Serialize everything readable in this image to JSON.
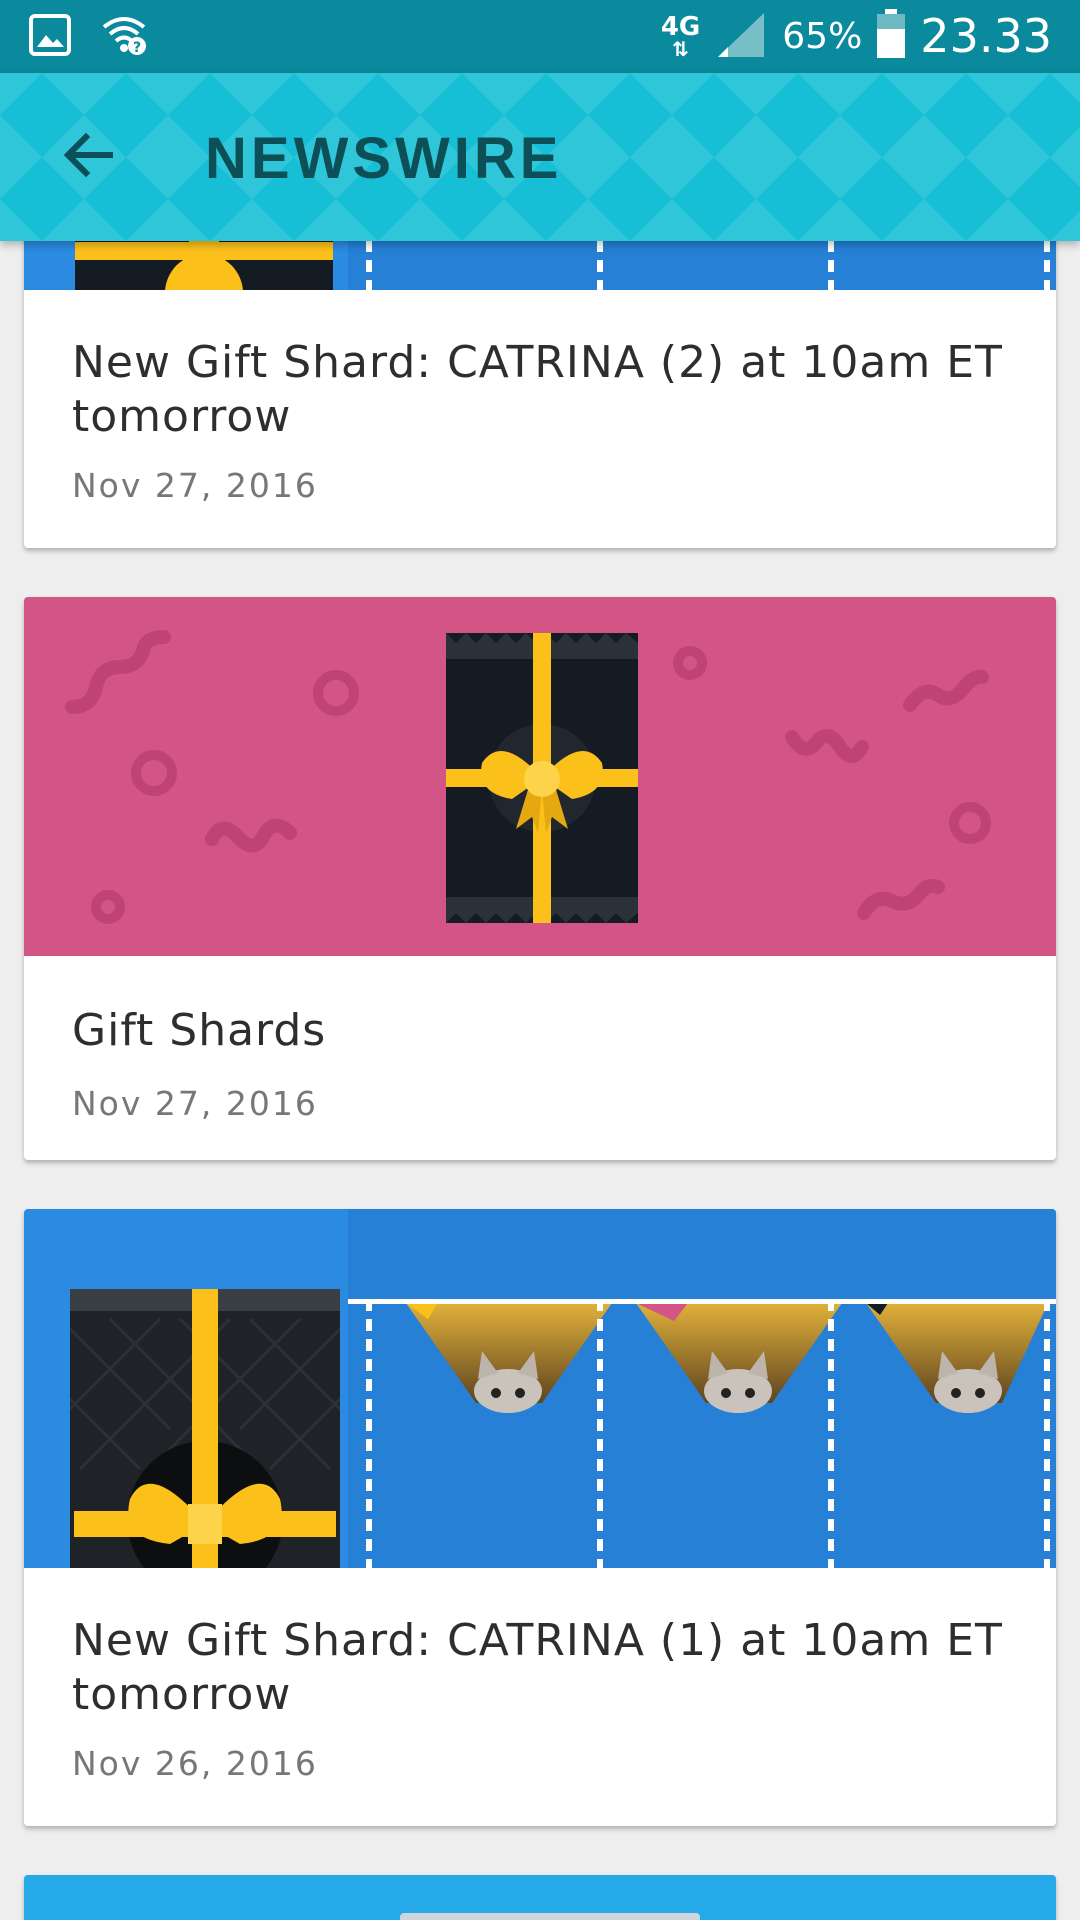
{
  "status_bar": {
    "network_type": "4G",
    "battery_percent": "65%",
    "time": "23.33",
    "icons": [
      "gallery-icon",
      "wifi-question-icon",
      "data-arrows-icon",
      "signal-icon",
      "battery-icon"
    ]
  },
  "app_bar": {
    "title": "NEWSWIRE",
    "back_icon": "arrow-left-icon"
  },
  "feed": [
    {
      "title": "New Gift Shard: CATRINA (2) at 10am ET tomorrow",
      "date": "Nov 27, 2016",
      "banner_color": "#2a8be0"
    },
    {
      "title": "Gift Shards",
      "date": "Nov 27, 2016",
      "banner_color": "#d25585"
    },
    {
      "title": "New Gift Shard: CATRINA (1) at 10am ET tomorrow",
      "date": "Nov 26, 2016",
      "banner_color": "#2a8be0"
    }
  ],
  "colors": {
    "status_bar": "#0a8a9c",
    "app_bar": "#17bfd6",
    "title_text": "#0d4f56",
    "ribbon": "#fcc01a",
    "package": "#151b22"
  }
}
